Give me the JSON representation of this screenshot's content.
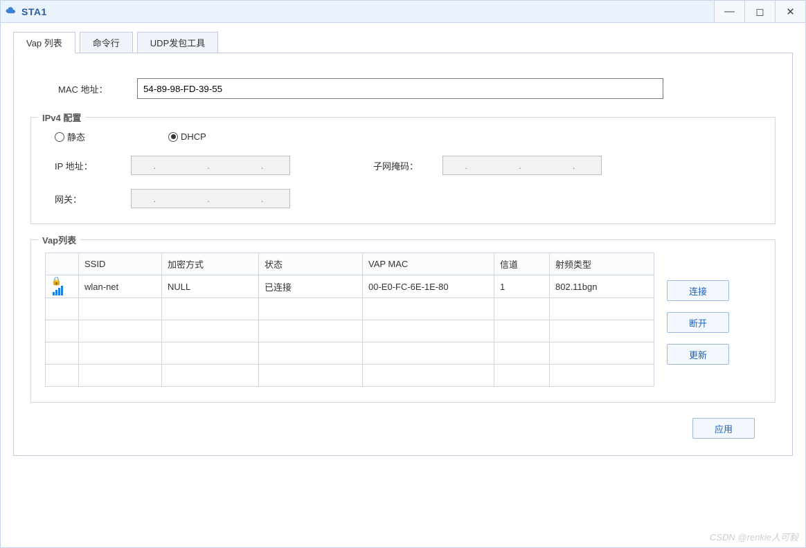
{
  "window": {
    "title": "STA1"
  },
  "tabs": [
    {
      "label": "Vap 列表",
      "active": true
    },
    {
      "label": "命令行",
      "active": false
    },
    {
      "label": "UDP发包工具",
      "active": false
    }
  ],
  "mac": {
    "label": "MAC 地址：",
    "value": "54-89-98-FD-39-55"
  },
  "ipv4": {
    "legend": "IPv4 配置",
    "radio_static": "静态",
    "radio_dhcp": "DHCP",
    "selected": "dhcp",
    "ip_label": "IP 地址：",
    "ip_value": ".       .       .",
    "mask_label": "子网掩码：",
    "mask_value": ".       .       .",
    "gateway_label": "网关：",
    "gateway_value": ".       .       ."
  },
  "vap": {
    "legend": "Vap列表",
    "columns": {
      "icon": "",
      "ssid": "SSID",
      "enc": "加密方式",
      "status": "状态",
      "mac": "VAP MAC",
      "channel": "信道",
      "rf": "射频类型"
    },
    "rows": [
      {
        "ssid": "wlan-net",
        "enc": "NULL",
        "status": "已连接",
        "mac": "00-E0-FC-6E-1E-80",
        "channel": "1",
        "rf": "802.11bgn",
        "locked": true
      }
    ],
    "empty_rows": 4
  },
  "buttons": {
    "connect": "连接",
    "disconnect": "断开",
    "refresh": "更新",
    "apply": "应用"
  },
  "watermark": "CSDN @renkie人可毅"
}
